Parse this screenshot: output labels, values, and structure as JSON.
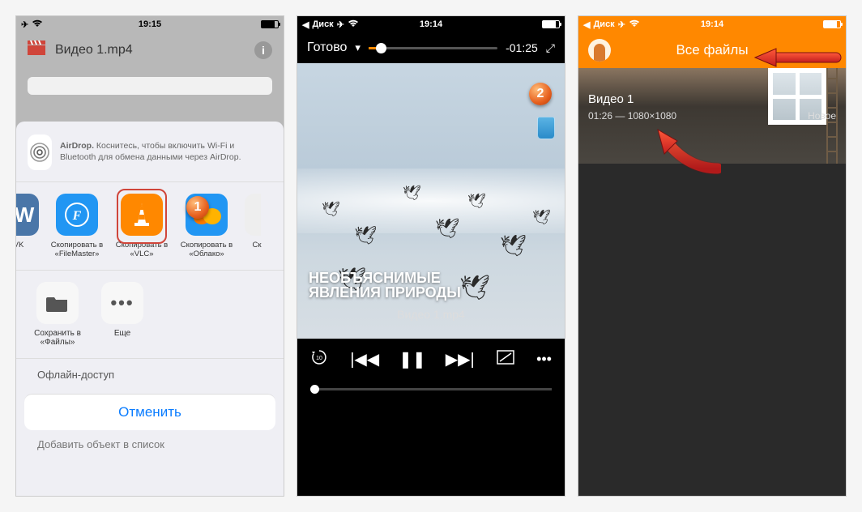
{
  "screen1": {
    "status": {
      "time": "19:15"
    },
    "header": {
      "title": "Видео 1.mp4"
    },
    "airdrop": {
      "title": "AirDrop.",
      "text": "Коснитесь, чтобы включить Wi-Fi и Bluetooth для обмена данными через AirDrop."
    },
    "apps": {
      "vk": "VK",
      "filemaster": "Скопировать в «FileMaster»",
      "vlc": "Скопировать в «VLC»",
      "cloud": "Скопировать в «Облако»",
      "edgeRight": "Ск"
    },
    "actions": {
      "saveFiles": "Сохранить в «Файлы»",
      "more": "Еще"
    },
    "under1": "Офлайн-доступ",
    "cancel": "Отменить",
    "under2": "Добавить объект в список"
  },
  "callouts": {
    "one": "1",
    "two": "2"
  },
  "screen2": {
    "status": {
      "back": "Диск",
      "time": "19:14"
    },
    "done": "Готово",
    "time_remaining": "-01:25",
    "caption_line1": "НЕОБЪЯСНИМЫЕ",
    "caption_line2": "ЯВЛЕНИЯ ПРИРОДЫ",
    "filename": "Видео 1.mp4"
  },
  "screen3": {
    "status": {
      "back": "Диск",
      "time": "19:14"
    },
    "header_title": "Все файлы",
    "item": {
      "title": "Видео 1",
      "sub_time": "01:26",
      "sub_sep": " — ",
      "sub_res": "1080×1080",
      "new_badge": "Новое"
    }
  }
}
